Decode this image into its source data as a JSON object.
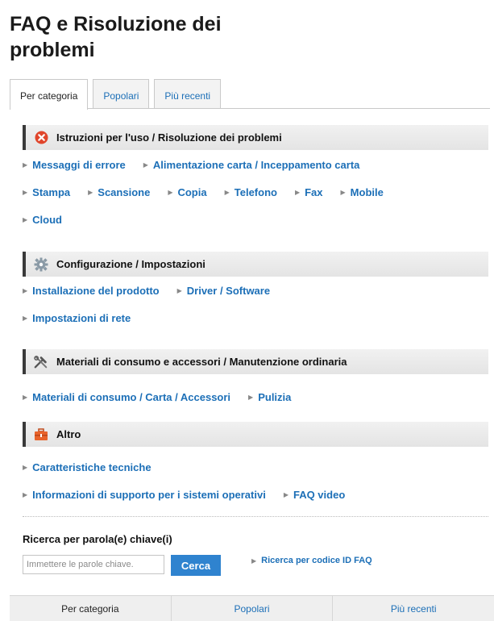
{
  "page_title": "FAQ e Risoluzione dei problemi",
  "tabs": [
    {
      "label": "Per categoria"
    },
    {
      "label": "Popolari"
    },
    {
      "label": "Più recenti"
    }
  ],
  "sections": [
    {
      "title": "Istruzioni per l'uso / Risoluzione dei problemi",
      "icon": "error-circle-icon",
      "links": [
        [
          "Messaggi di errore",
          "Alimentazione carta / Inceppamento carta"
        ],
        [
          "Stampa",
          "Scansione",
          "Copia",
          "Telefono",
          "Fax",
          "Mobile"
        ],
        [
          "Cloud"
        ]
      ]
    },
    {
      "title": "Configurazione / Impostazioni",
      "icon": "gear-icon",
      "links": [
        [
          "Installazione del prodotto",
          "Driver / Software"
        ],
        [
          "Impostazioni di rete"
        ]
      ]
    },
    {
      "title": "Materiali di consumo e accessori / Manutenzione ordinaria",
      "icon": "tools-icon",
      "links": [
        [
          "Materiali di consumo / Carta / Accessori",
          "Pulizia"
        ]
      ]
    },
    {
      "title": "Altro",
      "icon": "toolbox-icon",
      "links": [
        [
          "Caratteristiche tecniche"
        ],
        [
          "Informazioni di supporto per i sistemi operativi",
          "FAQ video"
        ]
      ]
    }
  ],
  "search": {
    "label": "Ricerca per parola(e) chiave(i)",
    "placeholder": "Immettere le parole chiave.",
    "value": "",
    "button": "Cerca",
    "faq_id_link": "Ricerca per codice ID FAQ"
  },
  "bottom_tabs": [
    {
      "label": "Per categoria"
    },
    {
      "label": "Popolari"
    },
    {
      "label": "Più recenti"
    }
  ],
  "colors": {
    "link": "#1c6fb7",
    "button": "#2f83cf",
    "error_icon": "#e0452b",
    "toolbox_icon": "#e8632b"
  }
}
